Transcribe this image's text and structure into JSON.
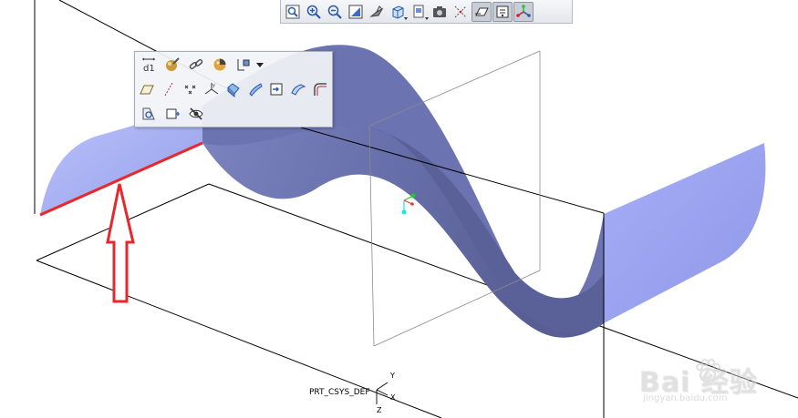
{
  "app": {
    "window": "3D modeling viewport (surface preview)"
  },
  "view_toolbar": {
    "buttons": [
      {
        "icon": "zoom-window-icon",
        "pressed": false
      },
      {
        "icon": "zoom-in-icon",
        "pressed": false
      },
      {
        "icon": "zoom-out-icon",
        "pressed": false
      },
      {
        "icon": "refit-icon",
        "pressed": false
      },
      {
        "icon": "reorient-icon",
        "pressed": false
      },
      {
        "icon": "display-style-icon",
        "pressed": false
      },
      {
        "icon": "saved-views-icon",
        "pressed": false
      },
      {
        "icon": "view-manager-icon",
        "pressed": false
      },
      {
        "icon": "datum-axes-icon",
        "pressed": false
      },
      {
        "icon": "datum-planes-icon",
        "pressed": true
      },
      {
        "icon": "datum-points-icon",
        "pressed": true
      },
      {
        "icon": "csys-display-icon",
        "pressed": true
      }
    ]
  },
  "mini_toolbar": {
    "row1": [
      "dimension-icon",
      "appearance-icon",
      "chain-link-icon",
      "color-sphere-icon",
      "sketch-icon"
    ],
    "row2": [
      "plane-icon",
      "axis-icon",
      "point-icon",
      "csys-icon",
      "extrude-icon",
      "sweep-icon",
      "insert-icon",
      "surface-icon",
      "round-icon"
    ],
    "row3": [
      "section-view-icon",
      "feature-icon",
      "hide-icon"
    ]
  },
  "model": {
    "surface_color": "#6e78b4",
    "surface_light_color": "#a3abef",
    "highlight_edge_color": "#e8262b",
    "arrow_color": "#e8262b"
  },
  "csys": {
    "name": "PRT_CSYS_DEF",
    "x_label": "X",
    "y_label": "Y",
    "z_label": "Z"
  },
  "watermark": {
    "logo": "Bai  经验",
    "url": "jingyan.baidu.com"
  }
}
